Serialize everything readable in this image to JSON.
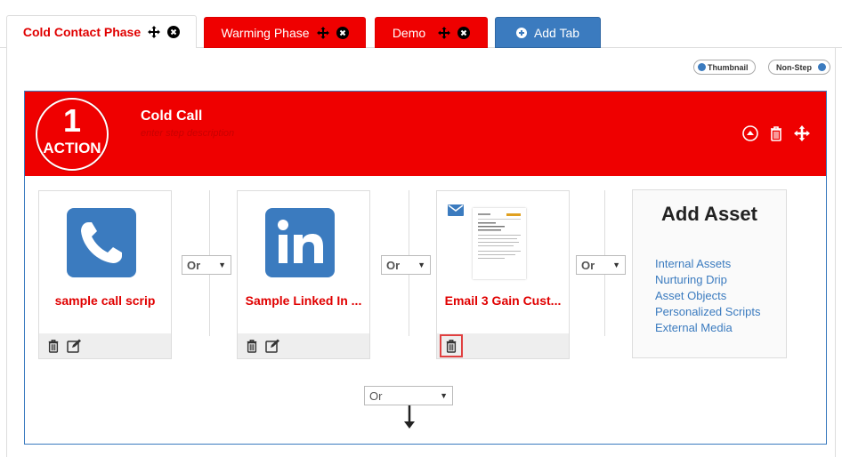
{
  "tabs": [
    {
      "label": "Cold Contact Phase"
    },
    {
      "label": "Warming Phase"
    },
    {
      "label": "Demo"
    },
    {
      "label": "Add Tab"
    }
  ],
  "view_toggles": {
    "thumbnail": "Thumbnail",
    "non_step": "Non-Step"
  },
  "step": {
    "number": "1",
    "type": "ACTION",
    "title": "Cold Call",
    "description_placeholder": "enter step description"
  },
  "assets": [
    {
      "title": "sample call scrip",
      "icon": "phone-icon"
    },
    {
      "title": "Sample Linked In ...",
      "icon": "linkedin-icon"
    },
    {
      "title": "Email 3 Gain Cust...",
      "icon": "email-thumbnail"
    }
  ],
  "connectors": [
    "Or",
    "Or",
    "Or"
  ],
  "bottom_connector": "Or",
  "add_asset": {
    "heading": "Add Asset",
    "links": [
      "Internal Assets",
      "Nurturing Drip",
      "Asset Objects",
      "Personalized Scripts",
      "External Media"
    ]
  },
  "colors": {
    "brand_red": "#ef0000",
    "brand_blue": "#3b7bbf"
  }
}
